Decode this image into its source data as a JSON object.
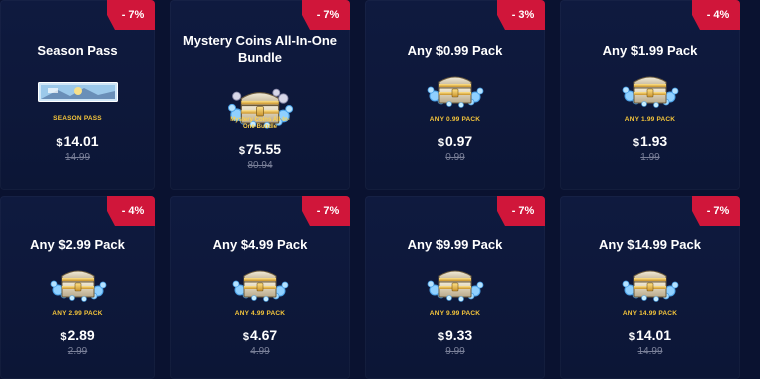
{
  "colors": {
    "background": "#0a1230",
    "card": "#0f1a3f",
    "badge": "#d0163a",
    "tag": "#f4c53b",
    "strikethrough": "#7a8099"
  },
  "cards": [
    {
      "title": "Season Pass",
      "discount": "- 7%",
      "art": "season-pass-banner",
      "tag": "SEASON PASS",
      "currency": "$",
      "price": "14.01",
      "original": "14.99"
    },
    {
      "title": "Mystery Coins All-In-One Bundle",
      "discount": "- 7%",
      "art": "coin-chest",
      "art_label": "Mystery Coins All-In-One-Bundle",
      "tag": "",
      "currency": "$",
      "price": "75.55",
      "original": "80.94"
    },
    {
      "title": "Any $0.99 Pack",
      "discount": "- 3%",
      "art": "treasure-chest",
      "tag": "ANY 0.99 PACK",
      "currency": "$",
      "price": "0.97",
      "original": "0.99"
    },
    {
      "title": "Any $1.99 Pack",
      "discount": "- 4%",
      "art": "treasure-chest",
      "tag": "ANY 1.99 PACK",
      "currency": "$",
      "price": "1.93",
      "original": "1.99"
    },
    {
      "title": "Any $2.99 Pack",
      "discount": "- 4%",
      "art": "treasure-chest",
      "tag": "ANY 2.99 PACK",
      "currency": "$",
      "price": "2.89",
      "original": "2.99"
    },
    {
      "title": "Any $4.99 Pack",
      "discount": "- 7%",
      "art": "treasure-chest",
      "tag": "ANY 4.99 PACK",
      "currency": "$",
      "price": "4.67",
      "original": "4.99"
    },
    {
      "title": "Any $9.99 Pack",
      "discount": "- 7%",
      "art": "treasure-chest",
      "tag": "ANY 9.99 PACK",
      "currency": "$",
      "price": "9.33",
      "original": "9.99"
    },
    {
      "title": "Any $14.99 Pack",
      "discount": "- 7%",
      "art": "treasure-chest",
      "tag": "ANY 14.99 PACK",
      "currency": "$",
      "price": "14.01",
      "original": "14.99"
    }
  ]
}
